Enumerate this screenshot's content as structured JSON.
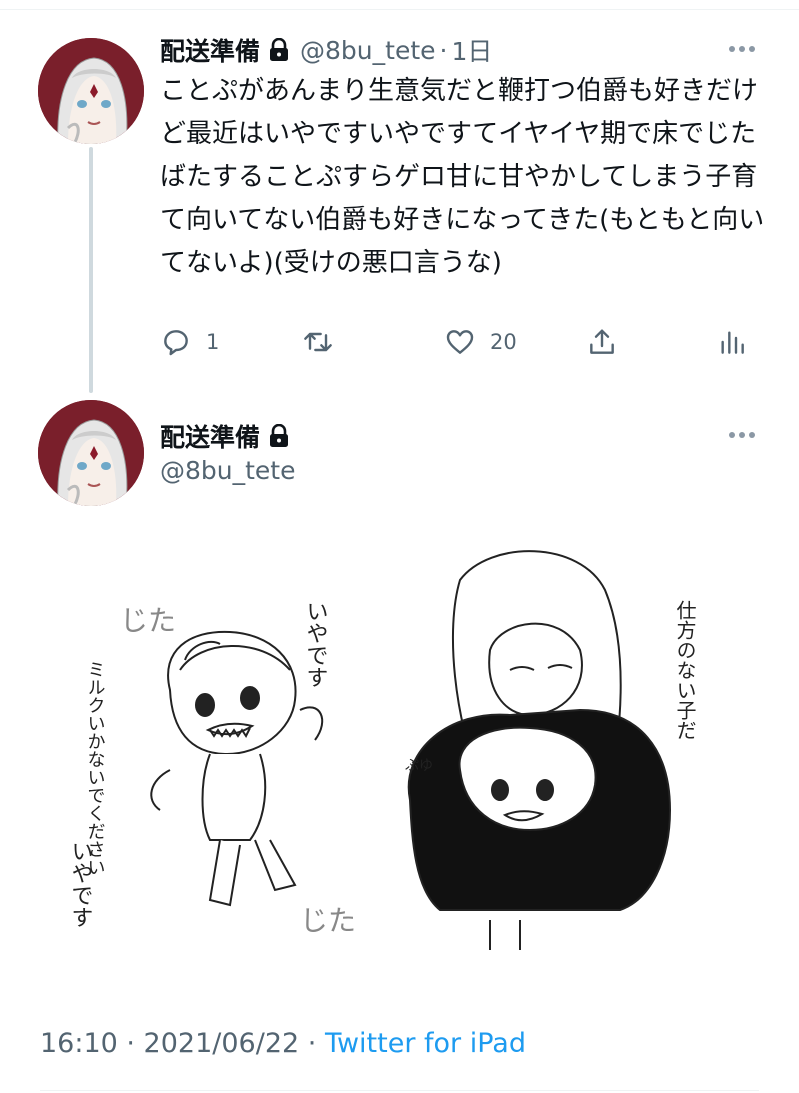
{
  "reply_tweet": {
    "display_name": "配送準備",
    "handle": "@8bu_tete",
    "separator": "·",
    "time": "1日",
    "text": "ことぷがあんまり生意気だと鞭打つ伯爵も好きだけど最近はいやですいやですてイヤイヤ期で床でじたばたすることぷすらゲロ甘に甘やかしてしまう子育て向いてない伯爵も好きになってきた(もともと向いてないよ)(受けの悪口言うな)",
    "actions": {
      "reply_count": "1",
      "retweet_count": "",
      "like_count": "20"
    }
  },
  "main_tweet": {
    "display_name": "配送準備",
    "handle": "@8bu_tete",
    "illustration_text": {
      "jita_top": "じた",
      "iyadesu_top": "いやです",
      "left_vertical": "ミルクいかないでください",
      "iyadesu_bottom": "いやです",
      "jita_bottom": "じた",
      "right_vertical": "仕方のない子だ",
      "puyu": "ぷゆ"
    },
    "timestamp": "16:10 · 2021/06/22",
    "meta_separator": " · ",
    "source": "Twitter for iPad"
  },
  "colors": {
    "text_primary": "#0f1419",
    "text_secondary": "#536471",
    "link": "#1d9bf0",
    "avatar_bg": "#7a1f2b",
    "thread_line": "#cfd9de"
  },
  "icons": [
    "lock-icon",
    "more-icon",
    "reply-icon",
    "retweet-icon",
    "like-icon",
    "share-icon",
    "analytics-icon"
  ]
}
